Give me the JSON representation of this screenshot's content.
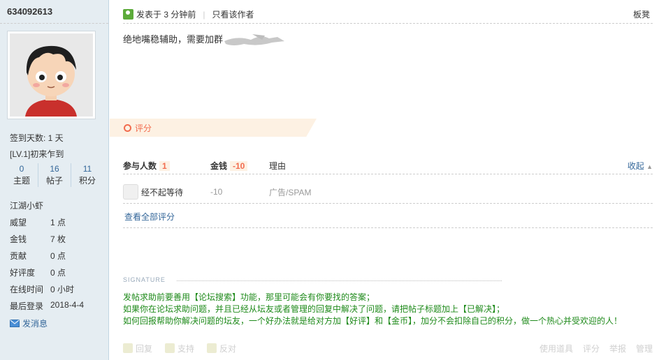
{
  "user": {
    "id": "634092613",
    "checkin_days": "签到天数: 1 天",
    "level": "[LV.1]初来乍到",
    "counts": [
      {
        "num": "0",
        "label": "主题"
      },
      {
        "num": "16",
        "label": "帖子"
      },
      {
        "num": "11",
        "label": "积分"
      }
    ],
    "group": "江湖小虾",
    "stats": [
      {
        "k": "威望",
        "v": "1 点"
      },
      {
        "k": "金钱",
        "v": "7 枚"
      },
      {
        "k": "贡献",
        "v": "0 点"
      },
      {
        "k": "好评度",
        "v": "0 点"
      },
      {
        "k": "在线时间",
        "v": "0 小时"
      },
      {
        "k": "最后登录",
        "v": "2018-4-4"
      }
    ],
    "send_msg": "发消息"
  },
  "post": {
    "posted": "发表于 3 分钟前",
    "author_only": "只看该作者",
    "floor": "板凳",
    "content": "绝地嘴稳辅助，需要加群"
  },
  "rating": {
    "title": "评分",
    "participants_label": "参与人数",
    "participants": "1",
    "money_label": "金钱",
    "money_total": "-10",
    "reason_label": "理由",
    "collapse": "收起",
    "rows": [
      {
        "user": "经不起等待",
        "value": "-10",
        "reason": "广告/SPAM"
      }
    ],
    "view_all": "查看全部评分"
  },
  "signature": {
    "label": "SIGNATURE",
    "line1": "发帖求助前要善用【论坛搜索】功能，那里可能会有你要找的答案；",
    "line2": "如果你在论坛求助问题，并且已经从坛友或者管理的回复中解决了问题，请把帖子标题加上【已解决】；",
    "line3": "如何回报帮助你解决问题的坛友，一个好办法就是给对方加【好评】和【金币】，加分不会扣除自己的积分，做一个热心并受欢迎的人！"
  },
  "actions": {
    "reply": "回复",
    "support": "支持",
    "oppose": "反对",
    "tools": "使用道具",
    "rate": "评分",
    "report": "举报",
    "manage": "管理"
  }
}
